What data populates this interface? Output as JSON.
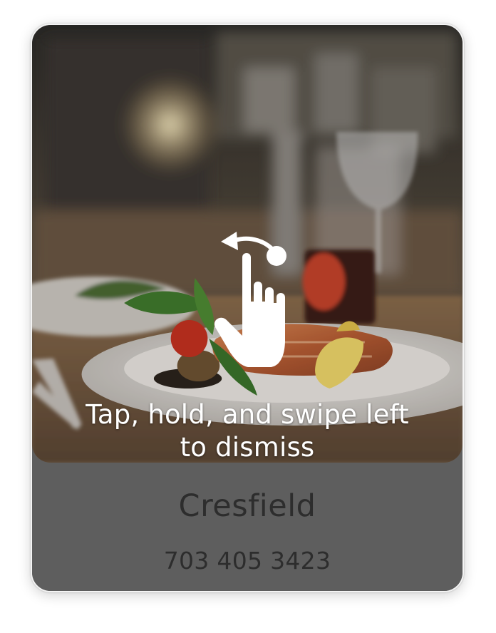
{
  "card": {
    "hint_line1": "Tap, hold, and swipe left",
    "hint_line2": "to dismiss",
    "restaurant_name": "Cresfield",
    "phone": "703 405 3423"
  },
  "icons": {
    "gesture": "swipe-left-hand-icon"
  },
  "colors": {
    "info_panel_bg": "#5e5e5e",
    "text_dark": "#2d2d2d",
    "hint_text": "#ffffff"
  }
}
